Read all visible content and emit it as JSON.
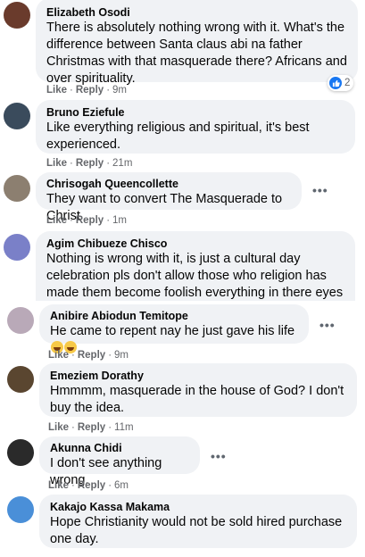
{
  "comments": [
    {
      "name": "Elizabeth Osodi",
      "text": "There is absolutely nothing wrong with it. What's the difference between Santa claus abi na father Christmas with that masquerade there? Africans and over spirituality.",
      "like": "Like",
      "reply": "Reply",
      "time": "9m",
      "reaction_count": "2",
      "avatar_color": "#6a3b2c"
    },
    {
      "name": "Bruno Eziefule",
      "text": "Like everything religious and spiritual, it's best experienced.",
      "like": "Like",
      "reply": "Reply",
      "time": "21m",
      "avatar_color": "#3a4b5c"
    },
    {
      "name": "Chrisogah Queencollette",
      "text": "They want to convert The Masquerade to Christ",
      "like": "Like",
      "reply": "Reply",
      "time": "1m",
      "avatar_color": "#8c7f70"
    },
    {
      "name": "Agim Chibueze Chisco",
      "text": "Nothing is wrong with it, is just a cultural day celebration pls don't allow those who religion has made them become foolish everything in there eyes now is evil",
      "avatar_color": "#7a80c8"
    },
    {
      "name": "Anibire Abiodun Temitope",
      "text": "He came to repent nay he just gave his life",
      "like": "Like",
      "reply": "Reply",
      "time": "9m",
      "avatar_color": "#b9a9b8"
    },
    {
      "name": "Emeziem Dorathy",
      "text": "Hmmmm, masquerade in the house of God? I don't buy the idea.",
      "like": "Like",
      "reply": "Reply",
      "time": "11m",
      "avatar_color": "#5a4630"
    },
    {
      "name": "Akunna Chidi",
      "text": "I don't see anything wrong.",
      "like": "Like",
      "reply": "Reply",
      "time": "6m",
      "avatar_color": "#2a2a2a"
    },
    {
      "name": "Kakajo Kassa Makama",
      "text": "Hope Christianity would not be sold hired purchase one day.",
      "avatar_color": "#4a8fd8"
    }
  ],
  "more_icon": "ellipsis-icon",
  "like_icon": "thumbs-up-icon"
}
